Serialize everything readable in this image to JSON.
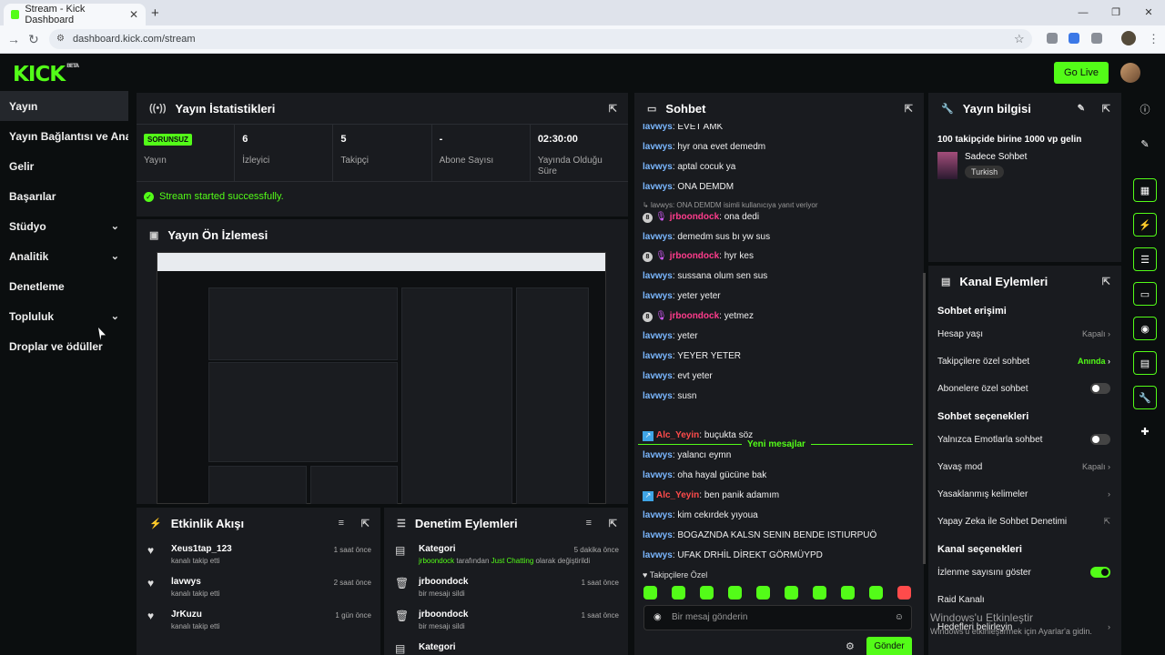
{
  "browser": {
    "tab_title": "Stream - Kick Dashboard",
    "url": "dashboard.kick.com/stream"
  },
  "app": {
    "logo": "KICK",
    "logo_sup": "BETA",
    "go_live": "Go Live"
  },
  "sidebar": {
    "items": [
      {
        "label": "Yayın"
      },
      {
        "label": "Yayın Bağlantısı ve Anahtarı"
      },
      {
        "label": "Gelir"
      },
      {
        "label": "Başarılar"
      },
      {
        "label": "Stüdyo"
      },
      {
        "label": "Analitik"
      },
      {
        "label": "Denetleme"
      },
      {
        "label": "Topluluk"
      },
      {
        "label": "Droplar ve ödüller"
      }
    ]
  },
  "stats": {
    "title": "Yayın İstatistikleri",
    "badge": "SORUNSUZ",
    "items": [
      {
        "value": "",
        "label": "Yayın"
      },
      {
        "value": "6",
        "label": "İzleyici"
      },
      {
        "value": "5",
        "label": "Takipçi"
      },
      {
        "value": "-",
        "label": "Abone Sayısı"
      },
      {
        "value": "02:30:00",
        "label": "Yayında Olduğu Süre"
      }
    ],
    "success": "Stream started successfully."
  },
  "preview": {
    "title": "Yayın Ön İzlemesi"
  },
  "activity": {
    "title": "Etkinlik Akışı",
    "items": [
      {
        "name": "Xeus1tap_123",
        "sub": "kanalı takip etti",
        "time": "1 saat önce"
      },
      {
        "name": "lavwys",
        "sub": "kanalı takip etti",
        "time": "2 saat önce"
      },
      {
        "name": "JrKuzu",
        "sub": "kanalı takip etti",
        "time": "1 gün önce"
      }
    ]
  },
  "moderation": {
    "title": "Denetim Eylemleri",
    "items": [
      {
        "name": "Kategori",
        "actor": "jrboondock",
        "mid": " tarafından ",
        "target": "Just Chatting",
        "end": " olarak değiştirildi",
        "time": "5 dakika önce"
      },
      {
        "name": "jrboondock",
        "sub": "bir mesajı sildi",
        "time": "1 saat önce"
      },
      {
        "name": "jrboondock",
        "sub": "bir mesajı sildi",
        "time": "1 saat önce"
      },
      {
        "name": "Kategori"
      }
    ]
  },
  "chat": {
    "title": "Sohbet",
    "messages": [
      {
        "user": "lavwys",
        "text": ": EVET AMK"
      },
      {
        "user": "lavwys",
        "text": ": hyr ona evet demedm"
      },
      {
        "user": "lavwys",
        "text": ": aptal cocuk ya"
      },
      {
        "user": "lavwys",
        "text": ": ONA DEMDM"
      },
      {
        "user": "jrboondock",
        "text": ": ona dedi",
        "badge": "8"
      },
      {
        "user": "lavwys",
        "text": ": demedm sus bı yw sus"
      },
      {
        "user": "jrboondock",
        "text": ": hyr kes",
        "badge": "8"
      },
      {
        "user": "lavwys",
        "text": ": sussana olum sen sus"
      },
      {
        "user": "lavwys",
        "text": ": yeter yeter"
      },
      {
        "user": "jrboondock",
        "text": ": yetmez",
        "badge": "8"
      },
      {
        "user": "lavwys",
        "text": ": yeter"
      },
      {
        "user": "lavwys",
        "text": ": YEYER YETER"
      },
      {
        "user": "lavwys",
        "text": ": evt yeter"
      },
      {
        "user": "lavwys",
        "text": ": susn"
      },
      {
        "user": "Alc_Yeyin",
        "text": ": buçukta söz"
      },
      {
        "user": "lavwys",
        "text": ": yalancı eymn"
      },
      {
        "user": "lavwys",
        "text": ": oha hayal gücüne bak"
      },
      {
        "user": "Alc_Yeyin",
        "text": ": ben panik adamım"
      },
      {
        "user": "lavwys",
        "text": ": kim cekırdek yıyoua"
      },
      {
        "user": "lavwys",
        "text": ": BOGAZNDA KALSN SENIN BENDE ISTIURPUÖ"
      },
      {
        "user": "lavwys",
        "text": ": UFAK DRHİL DİREKT GÖRMÜYPD"
      }
    ],
    "reply_note": "lavwys: ONA DEMDM isimli kullanıcıya yanıt veriyor",
    "new_messages": "Yeni mesajlar",
    "followers_only": "Takipçilere Özel",
    "input_placeholder": "Bir mesaj gönderin",
    "send": "Gönder"
  },
  "stream_info": {
    "title": "Yayın bilgisi",
    "stream_title": "100 takipçide birine 1000 vp gelin",
    "category": "Sadece Sohbet",
    "tag": "Turkish"
  },
  "channel_actions": {
    "title": "Kanal Eylemleri",
    "sections": [
      {
        "heading": "Sohbet erişimi"
      },
      {
        "heading": "Sohbet seçenekleri"
      },
      {
        "heading": "Kanal seçenekleri"
      }
    ],
    "rows": {
      "account_age": {
        "label": "Hesap yaşı",
        "value": "Kapalı"
      },
      "followers_only": {
        "label": "Takipçilere özel sohbet",
        "value": "Anında"
      },
      "subs_only": {
        "label": "Abonelere özel sohbet"
      },
      "emote_only": {
        "label": "Yalnızca Emotlarla sohbet"
      },
      "slow_mode": {
        "label": "Yavaş mod",
        "value": "Kapalı"
      },
      "banned_words": {
        "label": "Yasaklanmış kelimeler"
      },
      "ai_mod": {
        "label": "Yapay Zeka ile Sohbet Denetimi"
      },
      "show_viewers": {
        "label": "İzlenme sayısını göster"
      },
      "raid": {
        "label": "Raid Kanalı"
      },
      "goals": {
        "label": "Hedefleri belirleyin"
      }
    }
  },
  "watermark": {
    "line1": "Windows'u Etkinleştir",
    "line2": "Windows'u etkinleştirmek için Ayarlar'a gidin."
  }
}
